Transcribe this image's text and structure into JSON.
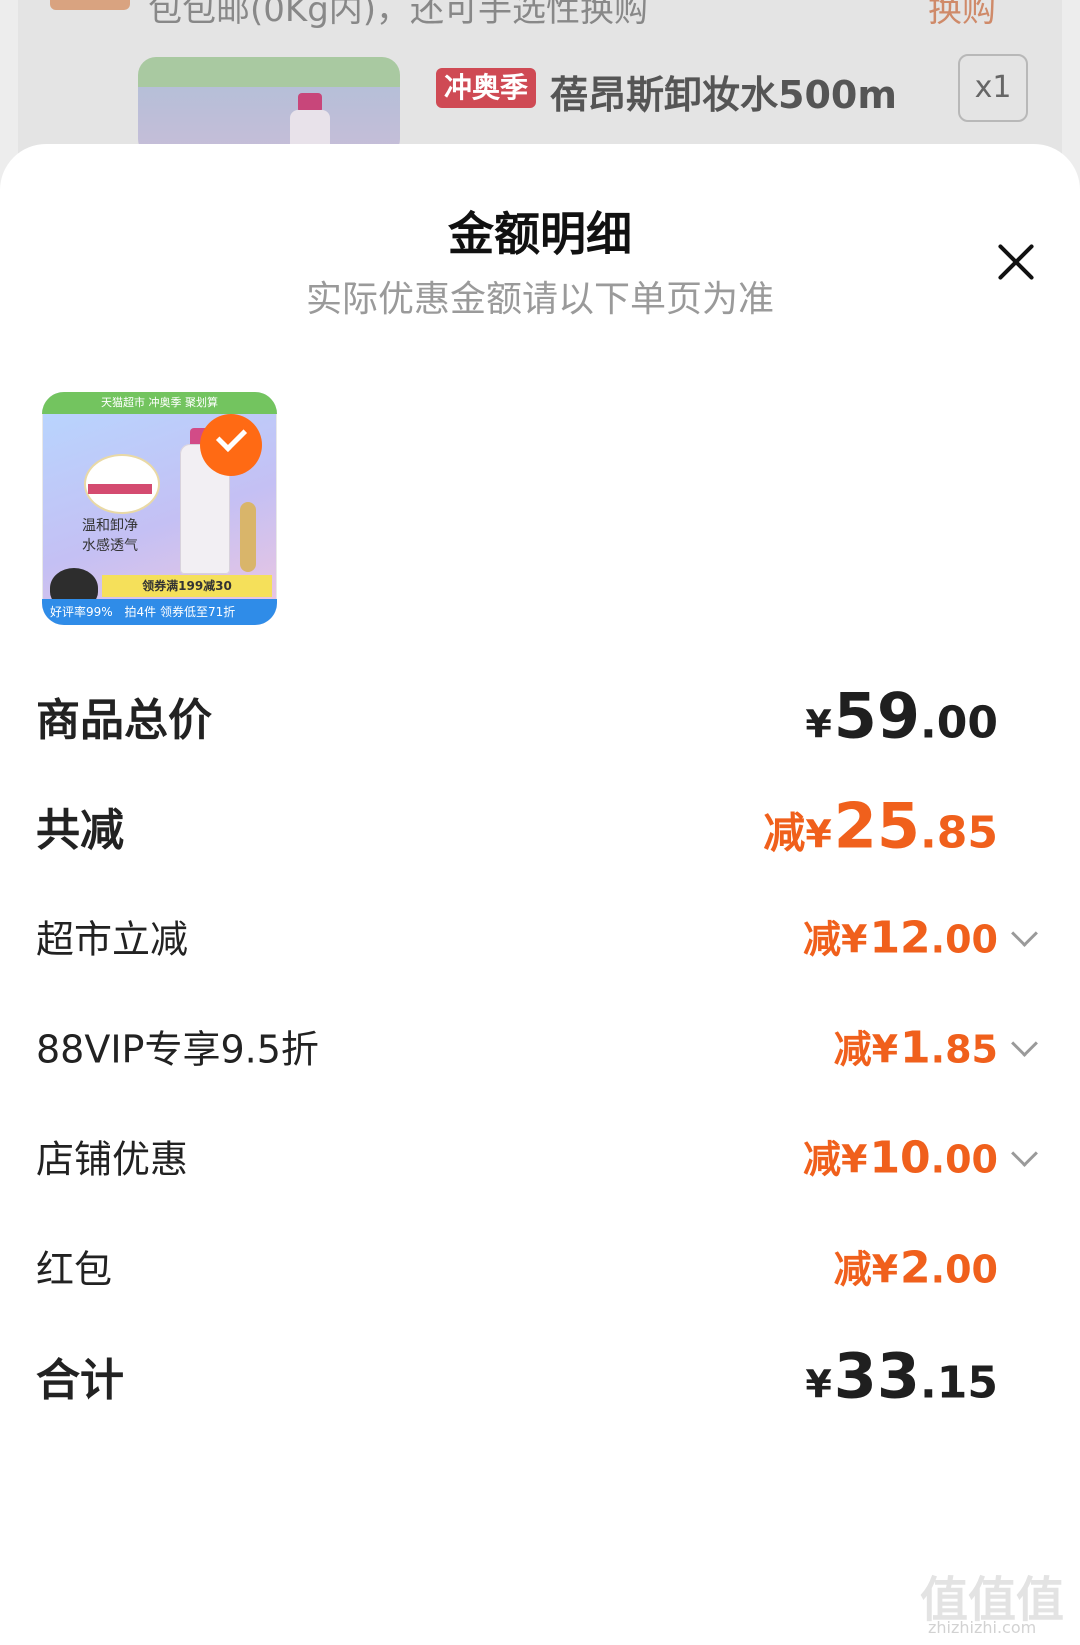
{
  "background": {
    "top_badge": "",
    "top_text": "包包邮(0Kg内)，还可手选性换购",
    "top_link": "换购",
    "product_tag": "冲奥季",
    "product_title": "蓓昂斯卸妆水500m",
    "product_qty": "x1"
  },
  "sheet": {
    "title": "金额明细",
    "subtitle": "实际优惠金额请以下单页为准"
  },
  "thumbnail": {
    "header": "天猫超市 冲奥季 聚划算",
    "text_line1": "温和卸净",
    "text_line2": "水感透气",
    "promo": "领券满199减30",
    "footer": "拍4件 领券低至71折",
    "rating": "好评率99%"
  },
  "rows": {
    "total": {
      "label": "商品总价",
      "currency": "¥",
      "int": "59",
      "dec": ".00"
    },
    "discount": {
      "label": "共减",
      "prefix": "减",
      "currency": "¥",
      "int": "25",
      "dec": ".85"
    },
    "supermarket": {
      "label": "超市立减",
      "prefix": "减",
      "currency": "¥",
      "int": "12",
      "dec": ".00"
    },
    "vip": {
      "label": "88VIP专享9.5折",
      "prefix": "减",
      "currency": "¥",
      "int": "1",
      "dec": ".85"
    },
    "store": {
      "label": "店铺优惠",
      "prefix": "减",
      "currency": "¥",
      "int": "10",
      "dec": ".00"
    },
    "redpacket": {
      "label": "红包",
      "prefix": "减",
      "currency": "¥",
      "int": "2",
      "dec": ".00"
    },
    "sum": {
      "label": "合计",
      "currency": "¥",
      "int": "33",
      "dec": ".15"
    }
  },
  "watermark": {
    "main": "值值值",
    "sub": "zhizhizhi.com"
  },
  "colors": {
    "accent": "#f0601c",
    "text": "#1f1f1f",
    "muted": "#9a9a9a",
    "check": "#ff6a14"
  }
}
